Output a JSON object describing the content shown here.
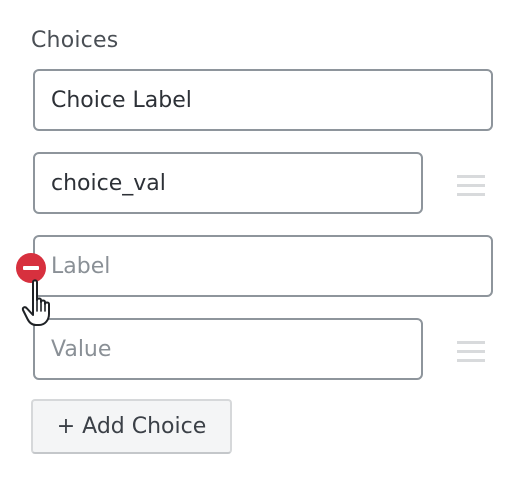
{
  "section": {
    "title": "Choices"
  },
  "choices": {
    "label_field": {
      "value": "Choice Label",
      "placeholder": ""
    },
    "value_field": {
      "value": "choice_val",
      "placeholder": ""
    },
    "new_label_field": {
      "value": "",
      "placeholder": "Label"
    },
    "new_value_field": {
      "value": "",
      "placeholder": "Value"
    }
  },
  "icons": {
    "remove": "minus-circle-icon",
    "drag": "drag-handle-icon",
    "cursor": "hand-pointer-cursor-icon"
  },
  "colors": {
    "remove_red": "#d7303e",
    "field_border": "#8e959c",
    "drag_handle": "#d8dadc"
  },
  "actions": {
    "add_choice_label": "+ Add Choice"
  }
}
